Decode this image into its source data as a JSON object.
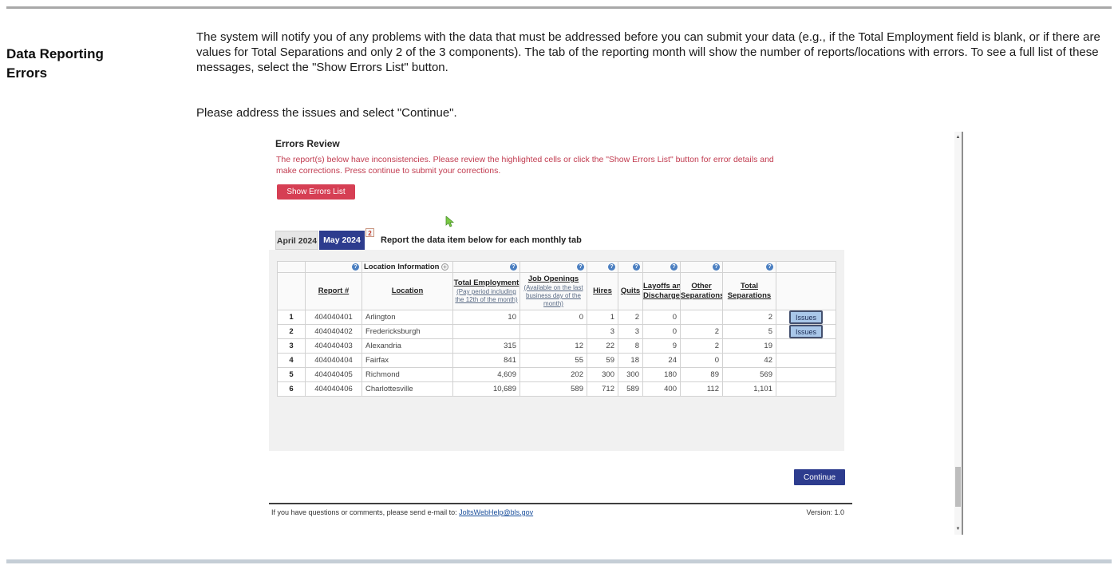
{
  "page": {
    "heading": "Data Reporting Errors",
    "paragraph1": "The system will notify you of any problems with the data that must be addressed before you can submit your data (e.g., if the Total Employment field is blank, or if there are values for Total Separations and only 2 of the 3 components). The tab of the reporting month will show the number of reports/locations with errors. To see a full list of these messages, select the \"Show Errors List\" button.",
    "paragraph2": "Please address the issues and select \"Continue\"."
  },
  "app": {
    "title": "Errors Review",
    "warning_line1": "The report(s) below have inconsistencies. Please review the highlighted cells or click the \"Show Errors List\" button for error details and",
    "warning_line2": "make corrections. Press continue to submit your corrections.",
    "show_errors_button": "Show Errors List",
    "tabs": [
      {
        "label": "April 2024",
        "active": false
      },
      {
        "label": "May 2024",
        "active": true,
        "badge": "2"
      }
    ],
    "tab_instruction": "Report the data item below for each monthly tab",
    "issues_button_label": "Issues",
    "continue_button": "Continue",
    "table": {
      "group_label": "Location Information",
      "col_report": "Report #",
      "col_location": "Location",
      "col_total_employment": "Total Employment",
      "col_total_employment_sub1": "(Pay period including",
      "col_total_employment_sub2": "the 12th of the month)",
      "col_job_openings": "Job Openings",
      "col_job_openings_sub1": "(Available on the last",
      "col_job_openings_sub2": "business day of the month)",
      "col_hires": "Hires",
      "col_quits": "Quits",
      "col_layoffs_line1": "Layoffs and",
      "col_layoffs_line2": "Discharges",
      "col_other_line1": "Other",
      "col_other_line2": "Separations",
      "col_total_sep_line1": "Total",
      "col_total_sep_line2": "Separations",
      "rows": [
        {
          "num": "1",
          "report": "404040401",
          "location": "Arlington",
          "total_employment": "10",
          "job_openings": "0",
          "hires": "1",
          "quits": "2",
          "layoffs_discharges": "0",
          "other_separations": "",
          "total_separations": "2",
          "highlighted_cell": "other_separations",
          "has_issues": true
        },
        {
          "num": "2",
          "report": "404040402",
          "location": "Fredericksburgh",
          "total_employment": "",
          "job_openings": "",
          "hires": "3",
          "quits": "3",
          "layoffs_discharges": "0",
          "other_separations": "2",
          "total_separations": "5",
          "highlighted_cell": "total_employment",
          "has_issues": true
        },
        {
          "num": "3",
          "report": "404040403",
          "location": "Alexandria",
          "total_employment": "315",
          "job_openings": "12",
          "hires": "22",
          "quits": "8",
          "layoffs_discharges": "9",
          "other_separations": "2",
          "total_separations": "19",
          "highlighted_cell": null,
          "has_issues": false
        },
        {
          "num": "4",
          "report": "404040404",
          "location": "Fairfax",
          "total_employment": "841",
          "job_openings": "55",
          "hires": "59",
          "quits": "18",
          "layoffs_discharges": "24",
          "other_separations": "0",
          "total_separations": "42",
          "highlighted_cell": null,
          "has_issues": false
        },
        {
          "num": "5",
          "report": "404040405",
          "location": "Richmond",
          "total_employment": "4,609",
          "job_openings": "202",
          "hires": "300",
          "quits": "300",
          "layoffs_discharges": "180",
          "other_separations": "89",
          "total_separations": "569",
          "highlighted_cell": null,
          "has_issues": false
        },
        {
          "num": "6",
          "report": "404040406",
          "location": "Charlottesville",
          "total_employment": "10,689",
          "job_openings": "589",
          "hires": "712",
          "quits": "589",
          "layoffs_discharges": "400",
          "other_separations": "112",
          "total_separations": "1,101",
          "highlighted_cell": null,
          "has_issues": false
        }
      ]
    },
    "footer": {
      "text": "If you have questions or comments, please send e-mail to: ",
      "email": "JoltsWebHelp@bls.gov",
      "version": "Version: 1.0"
    }
  },
  "colors": {
    "accent_navy": "#2d3c8e",
    "danger_red": "#d63f54",
    "warning_text": "#c13b4f",
    "error_cell_pink": "#f6dfdf",
    "issues_button_blue": "#a9c7e9",
    "link_blue": "#1a4f9c",
    "help_icon_blue": "#4b7fc1"
  }
}
